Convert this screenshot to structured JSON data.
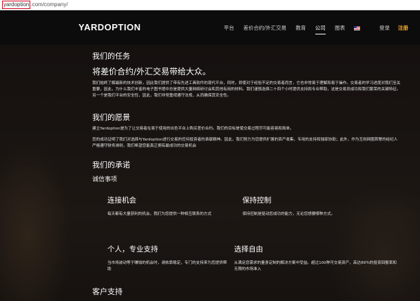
{
  "browser": {
    "url_domain": "yardoption",
    "url_path": ".com/company/"
  },
  "nav": {
    "logo": "YARDOPTION",
    "items": [
      {
        "label": "平台"
      },
      {
        "label": "差价合约/外汇交易"
      },
      {
        "label": "教育"
      },
      {
        "label": "公司",
        "active": true
      },
      {
        "label": "图表"
      }
    ],
    "flag_icon": "us-flag-icon",
    "login": "登录",
    "register": "注册"
  },
  "mission": {
    "heading": "我们的任务",
    "tagline": "将差价合约/外汇交易带给大众。",
    "body": "我们始终了解最新的技术创新，因此我们提供了带有先进工具软件的现代平台，同时，即使对于经验不足的交易者而言，它也非常易于理解和易于操作。交易者的学习进度对我们至关重要，因此，为什么我们丰富的电子图书馆中总是提供大量网络研讨会和其他有用的材料。我们谨慎选择二十四个小时提供支持和专业帮助，这是交易员成功和我们繁荣的关键特征。另一个是我们平台的安全性，因此，我们非常重视遵守法规，从而确保其安全性。"
  },
  "vision": {
    "heading": "我们的愿景",
    "body1": "建立Yardoption是为了让交易者在易于使用的出色平台上购买差价合约。我们的目标是使交易过程尽可能容易和简单。",
    "body2": "您的成功证明了我们对选择与Yardoption进行交易的任何投资者的承献精神。因此，我们努力为您提供扩展的资产收集，专用的支持和独家协助；此外，作为互则网圈首警的经纪人严格遵守财务准则，我们希望您能真正拥有最成功的交易机会"
  },
  "commitment": {
    "heading": "我们的承诺",
    "subheading": "诚信事项",
    "features": [
      {
        "title": "连接机会",
        "desc": "每天都有大量获利的机会，我们为您提供一种相互联系的方式"
      },
      {
        "title": "保持控制",
        "desc": "保持控制是驱动您成功的能力，无论您想要哪种方式。"
      },
      {
        "title": "个人，专业支持",
        "desc": "当市场波动等于赚钱的机会时，请依靠稳定，专门的支持来为您提供帮助"
      },
      {
        "title": "选择自由",
        "desc": "从满足您需求的量身定制的解决方案中受益。超过100种可交易资产，高达89％的投资回报率和无限的市场准入"
      }
    ]
  },
  "support": {
    "heading": "客户支持"
  }
}
